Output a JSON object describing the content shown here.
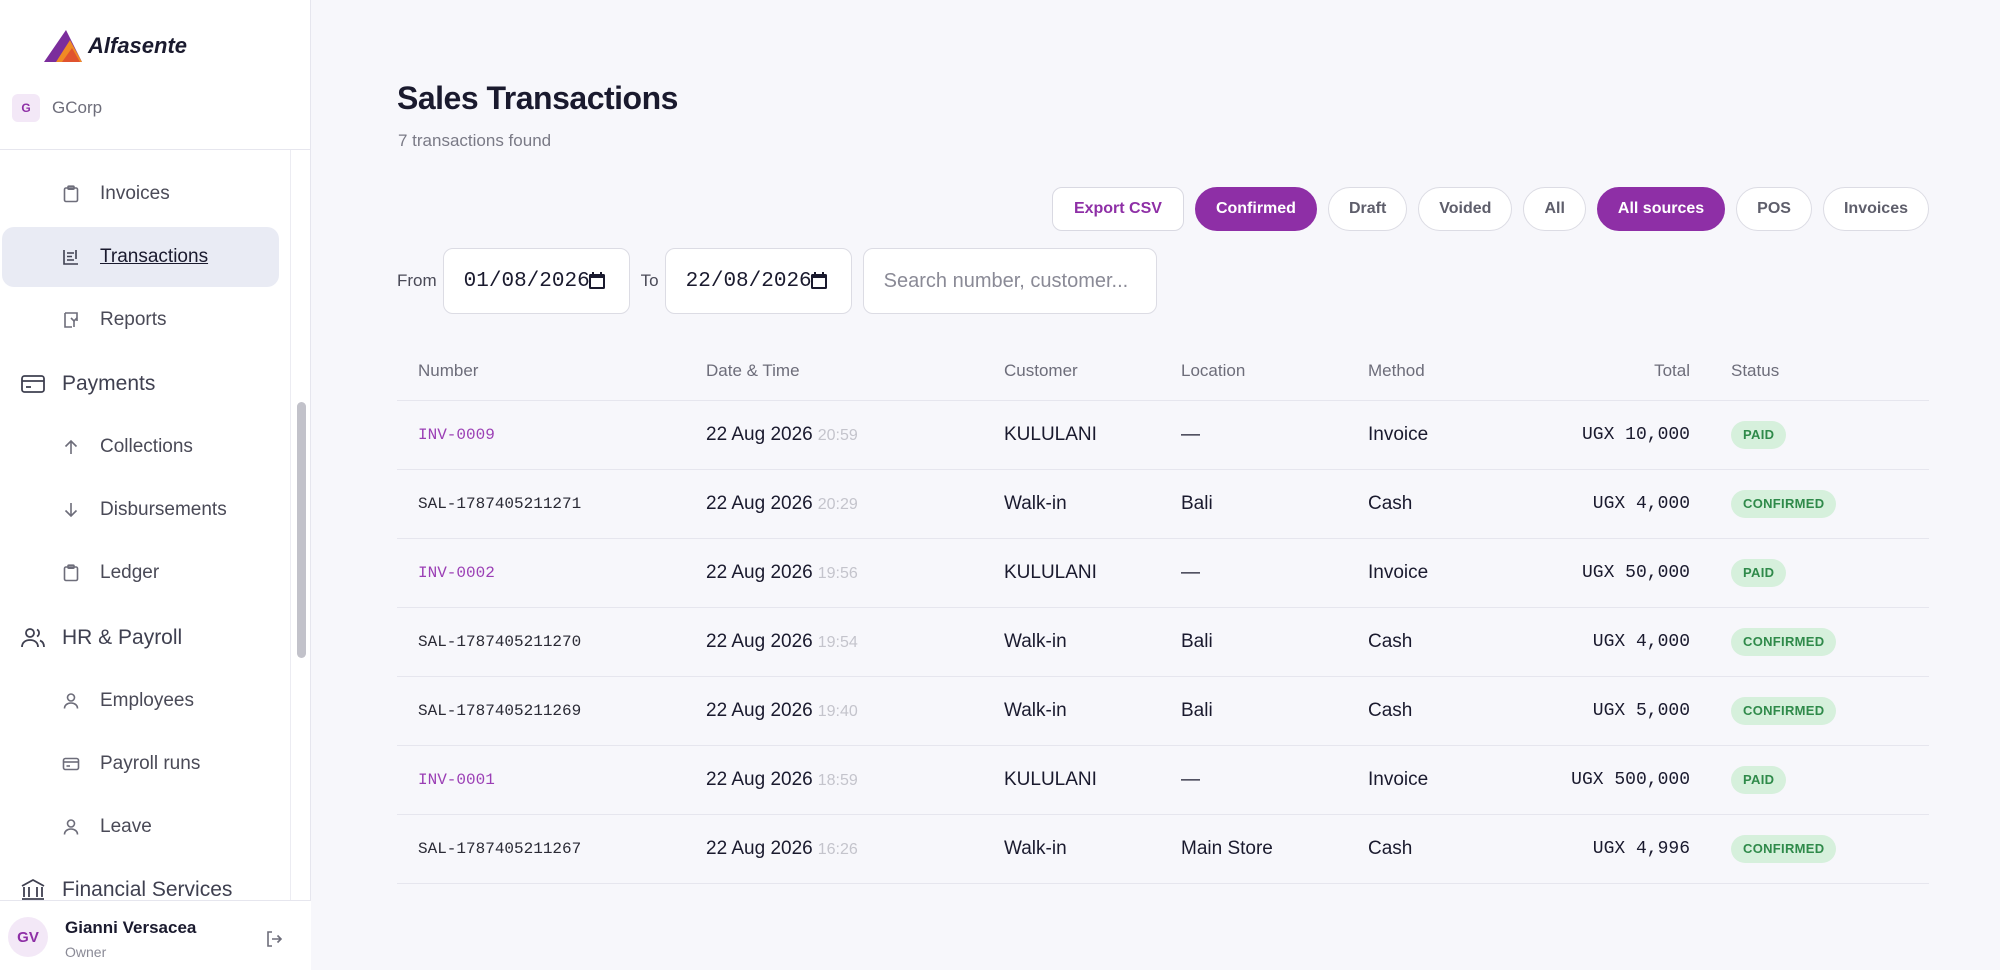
{
  "brand": {
    "name": "Alfasente"
  },
  "org": {
    "initial": "G",
    "name": "GCorp"
  },
  "nav": [
    {
      "label": "Invoices",
      "icon": "clipboard-icon"
    },
    {
      "label": "Transactions",
      "icon": "receipt-icon"
    },
    {
      "label": "Reports",
      "icon": "report-icon"
    },
    {
      "label": "Payments",
      "icon": "card-icon"
    },
    {
      "label": "Collections",
      "icon": "arrow-up-icon"
    },
    {
      "label": "Disbursements",
      "icon": "arrow-down-icon"
    },
    {
      "label": "Ledger",
      "icon": "clipboard-icon"
    },
    {
      "label": "HR & Payroll",
      "icon": "users-icon"
    },
    {
      "label": "Employees",
      "icon": "user-icon"
    },
    {
      "label": "Payroll runs",
      "icon": "card-icon"
    },
    {
      "label": "Leave",
      "icon": "user-icon"
    },
    {
      "label": "Financial Services",
      "icon": "bank-icon"
    }
  ],
  "user": {
    "initials": "GV",
    "name": "Gianni Versacea",
    "role": "Owner"
  },
  "page": {
    "title": "Sales Transactions",
    "subtitle": "7 transactions found"
  },
  "filters": {
    "export": "Export CSV",
    "status": [
      "Confirmed",
      "Draft",
      "Voided",
      "All"
    ],
    "source": [
      "All sources",
      "POS",
      "Invoices"
    ],
    "active_status": "Confirmed",
    "active_source": "All sources"
  },
  "date_filter": {
    "from_label": "From",
    "from_value": "01/08/2026",
    "to_label": "To",
    "to_value": "22/08/2026"
  },
  "search": {
    "placeholder": "Search number, customer..."
  },
  "table": {
    "columns": [
      "Number",
      "Date & Time",
      "Customer",
      "Location",
      "Method",
      "Total",
      "Status"
    ],
    "rows": [
      {
        "number": "INV-0009",
        "date": "22 Aug 2026",
        "time": "20:59",
        "customer": "KULULANI",
        "location": "—",
        "method": "Invoice",
        "total": "UGX 10,000",
        "status": "PAID"
      },
      {
        "number": "SAL-1787405211271",
        "date": "22 Aug 2026",
        "time": "20:29",
        "customer": "Walk-in",
        "location": "Bali",
        "method": "Cash",
        "total": "UGX 4,000",
        "status": "CONFIRMED"
      },
      {
        "number": "INV-0002",
        "date": "22 Aug 2026",
        "time": "19:56",
        "customer": "KULULANI",
        "location": "—",
        "method": "Invoice",
        "total": "UGX 50,000",
        "status": "PAID"
      },
      {
        "number": "SAL-1787405211270",
        "date": "22 Aug 2026",
        "time": "19:54",
        "customer": "Walk-in",
        "location": "Bali",
        "method": "Cash",
        "total": "UGX 4,000",
        "status": "CONFIRMED"
      },
      {
        "number": "SAL-1787405211269",
        "date": "22 Aug 2026",
        "time": "19:40",
        "customer": "Walk-in",
        "location": "Bali",
        "method": "Cash",
        "total": "UGX 5,000",
        "status": "CONFIRMED"
      },
      {
        "number": "INV-0001",
        "date": "22 Aug 2026",
        "time": "18:59",
        "customer": "KULULANI",
        "location": "—",
        "method": "Invoice",
        "total": "UGX 500,000",
        "status": "PAID"
      },
      {
        "number": "SAL-1787405211267",
        "date": "22 Aug 2026",
        "time": "16:26",
        "customer": "Walk-in",
        "location": "Main Store",
        "method": "Cash",
        "total": "UGX 4,996",
        "status": "CONFIRMED"
      }
    ]
  },
  "colors": {
    "accent": "#8e2fa6",
    "badge_bg": "#d6f0dc",
    "badge_text": "#2f8a4a",
    "invoice_link": "#9b3fb5"
  }
}
